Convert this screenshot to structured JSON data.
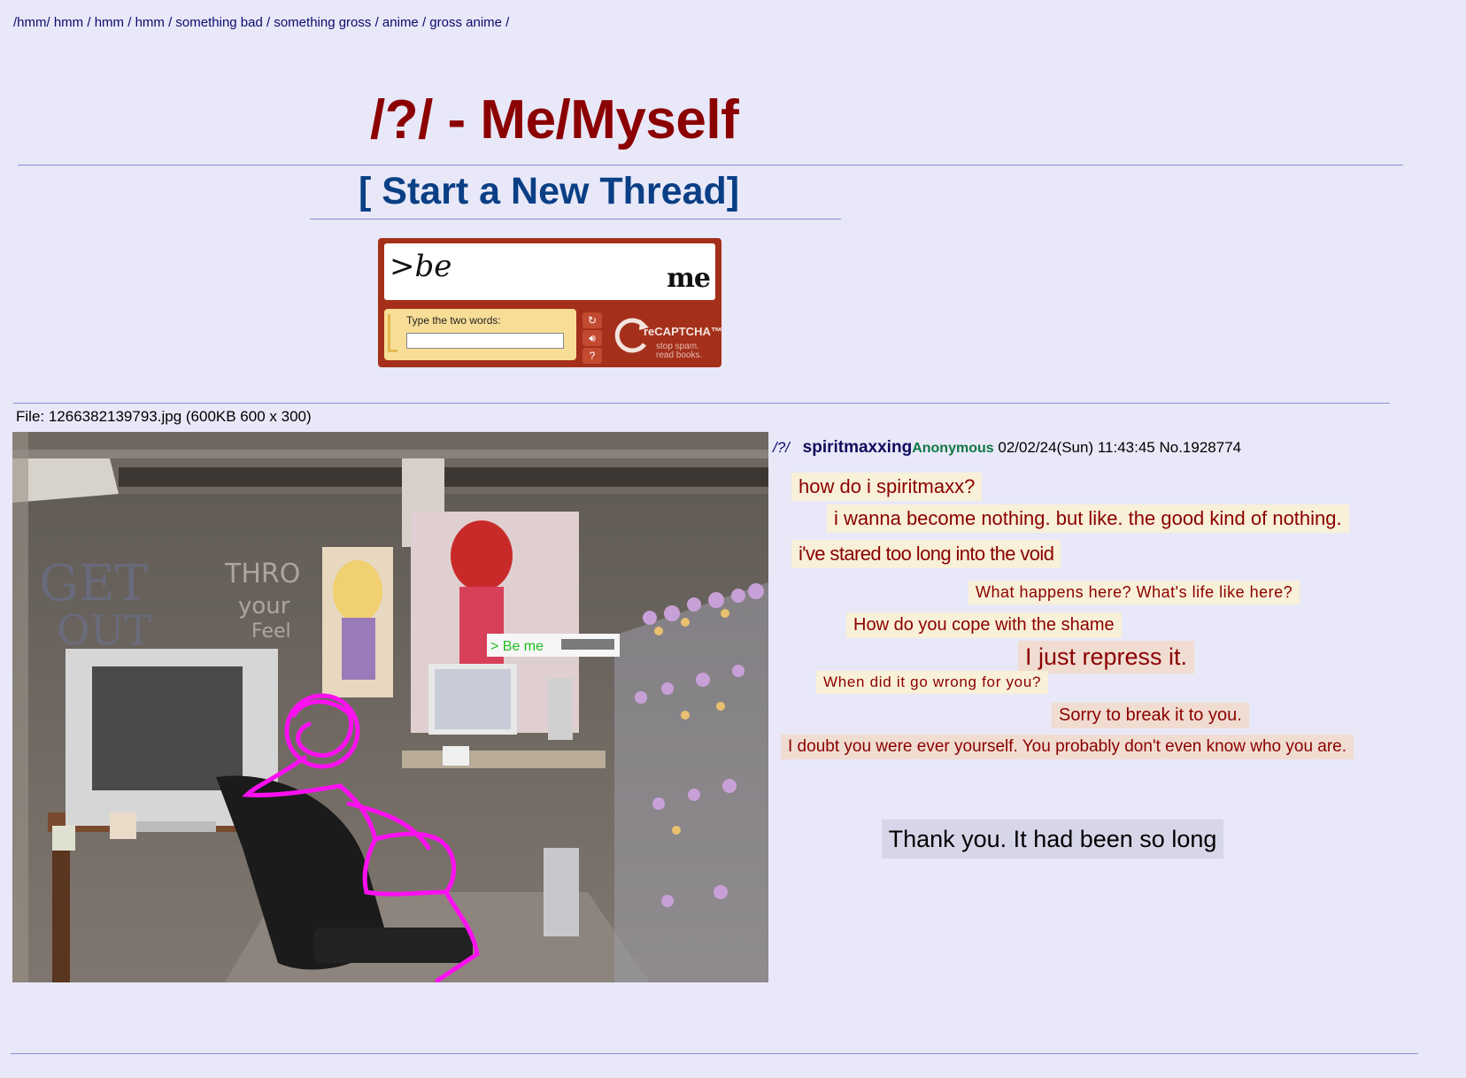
{
  "nav": {
    "items": [
      "/hmm/",
      "hmm",
      "hmm",
      "hmm",
      "something bad",
      "something gross",
      "anime",
      "gross anime"
    ],
    "trailing": "/"
  },
  "board": {
    "title": "/?/ - Me/Myself",
    "new_thread": "[ Start a New Thread]"
  },
  "captcha": {
    "word1": ">be",
    "word2": "me",
    "label": "Type the two words:",
    "input_value": "",
    "logo": "reCAPTCHA™",
    "tagline_1": "stop spam.",
    "tagline_2": "read books.",
    "buttons": [
      "refresh-icon",
      "audio-icon",
      "help-icon"
    ]
  },
  "file_info": "File: 1266382139793.jpg (600KB 600 x 300)",
  "image_overlay": {
    "greentext": "> Be me"
  },
  "post": {
    "board_tag": "/?/",
    "subject": "spiritmaxxing",
    "name": "Anonymous",
    "meta": "02/02/24(Sun) 11:43:45 No.1928774",
    "lines": [
      "how do i spiritmaxx?",
      "i wanna become nothing. but like. the good kind of nothing.",
      "i've stared too long into the void",
      "What happens here? What's life like here?",
      "How do you cope with the shame",
      "I just repress it.",
      "When did it go wrong for you?",
      "Sorry to break it to you.",
      "I doubt you were ever yourself. You probably don't even know who you are."
    ],
    "final": "Thank you. It had been so long"
  },
  "colors": {
    "background": "#e8e8f8",
    "title": "#8b0000",
    "link": "#0a3f85",
    "name": "#117743"
  }
}
